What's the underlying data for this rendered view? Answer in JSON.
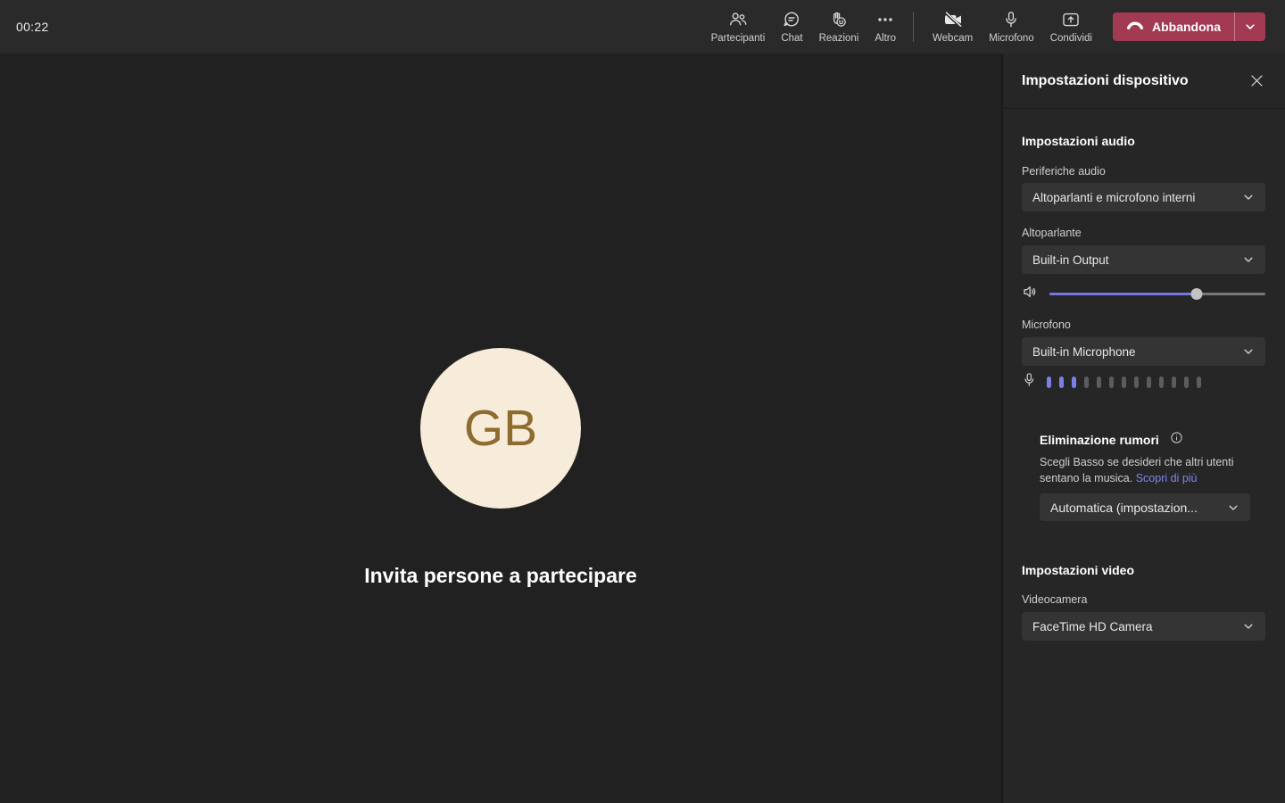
{
  "topbar": {
    "timer": "00:22",
    "items": [
      {
        "label": "Partecipanti"
      },
      {
        "label": "Chat"
      },
      {
        "label": "Reazioni"
      },
      {
        "label": "Altro"
      }
    ],
    "device_items": [
      {
        "label": "Webcam"
      },
      {
        "label": "Microfono"
      },
      {
        "label": "Condividi"
      }
    ],
    "leave_button": {
      "label": "Abbandona"
    }
  },
  "stage": {
    "avatar_initials": "GB",
    "invite_text": "Invita persone a partecipare"
  },
  "panel": {
    "title": "Impostazioni dispositivo",
    "audio": {
      "heading": "Impostazioni audio",
      "devices_label": "Periferiche audio",
      "devices_value": "Altoparlanti e microfono interni",
      "speaker_label": "Altoparlante",
      "speaker_value": "Built-in Output",
      "volume_percent": 68,
      "mic_label": "Microfono",
      "mic_value": "Built-in Microphone",
      "meter": {
        "total": 13,
        "active": 3
      },
      "noise": {
        "heading": "Eliminazione rumori",
        "description": "Scegli Basso se desideri che altri utenti sentano la musica.",
        "link": "Scopri di più",
        "value": "Automatica (impostazion..."
      }
    },
    "video": {
      "heading": "Impostazioni video",
      "camera_label": "Videocamera",
      "camera_value": "FaceTime HD Camera"
    }
  },
  "colors": {
    "accent": "#7578df",
    "leave_red": "#a33a53",
    "link": "#7e86ee",
    "avatar_bg": "#f7ecda",
    "avatar_text": "#8e6c30"
  }
}
